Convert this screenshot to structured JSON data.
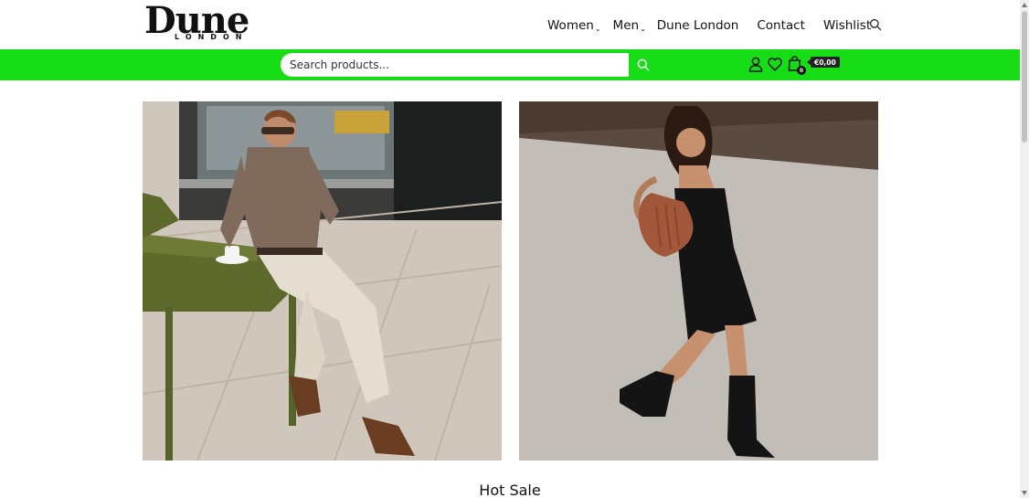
{
  "brand": {
    "logo_main": "Dune",
    "logo_sub": "LONDON"
  },
  "nav": {
    "items": [
      {
        "label": "Women",
        "has_dropdown": true
      },
      {
        "label": "Men",
        "has_dropdown": true
      },
      {
        "label": "Dune London",
        "has_dropdown": false
      },
      {
        "label": "Contact",
        "has_dropdown": false
      },
      {
        "label": "Wishlist",
        "has_dropdown": false
      }
    ],
    "caret": "⌄",
    "search_icon": "search-icon"
  },
  "search": {
    "placeholder": "Search products...",
    "button_icon": "search-icon"
  },
  "account": {
    "user_icon": "user-icon",
    "wishlist_icon": "heart-icon",
    "cart_icon": "shopping-bag-icon",
    "cart_count": "0",
    "cart_total": "€0,00"
  },
  "colors": {
    "accent": "#16dd16",
    "text": "#111111",
    "background": "#ffffff"
  },
  "hero": {
    "left_image": "men-lifestyle-photo",
    "right_image": "women-lifestyle-photo"
  },
  "sections": {
    "hot_sale_title": "Hot Sale"
  }
}
